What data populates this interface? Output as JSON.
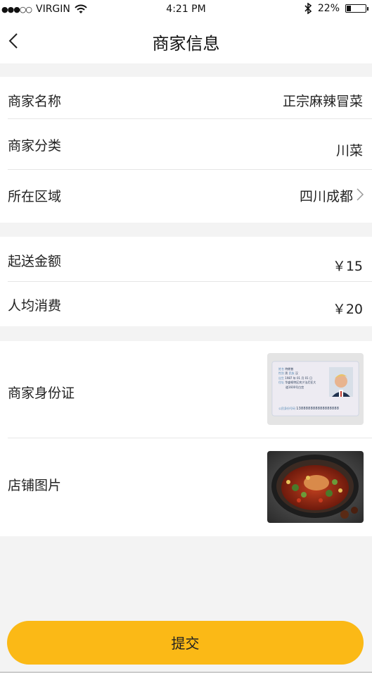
{
  "status_bar": {
    "signal": "●●●○○",
    "carrier": "VIRGIN",
    "time": "4:21 PM",
    "battery_text": "22%",
    "battery_level": 0.22
  },
  "nav": {
    "title": "商家信息"
  },
  "section1": [
    {
      "label": "商家名称",
      "value": "正宗麻辣冒菜"
    },
    {
      "label": "商家分类",
      "value": "川菜"
    },
    {
      "label": "所在区域",
      "value": "四川成都"
    }
  ],
  "section2": [
    {
      "label": "起送金额",
      "value": "￥15"
    },
    {
      "label": "人均消费",
      "value": "￥20"
    }
  ],
  "section3": [
    {
      "label": "商家身份证"
    },
    {
      "label": "店铺图片"
    }
  ],
  "id_card": {
    "name_label": "姓名",
    "name": "特朗普",
    "gender_label": "性别",
    "gender": "男",
    "ethnicity_label": "民族",
    "ethnicity": "汉",
    "birth_label": "出生",
    "birth": "1987 年 01 月 01 日",
    "address_label": "住址",
    "address_line1": "华盛顿特区宾夕法尼亚大",
    "address_line2": "道1600号白宫",
    "id_label": "公民身份号码",
    "id_number": "138888888888888888"
  },
  "submit_label": "提交"
}
